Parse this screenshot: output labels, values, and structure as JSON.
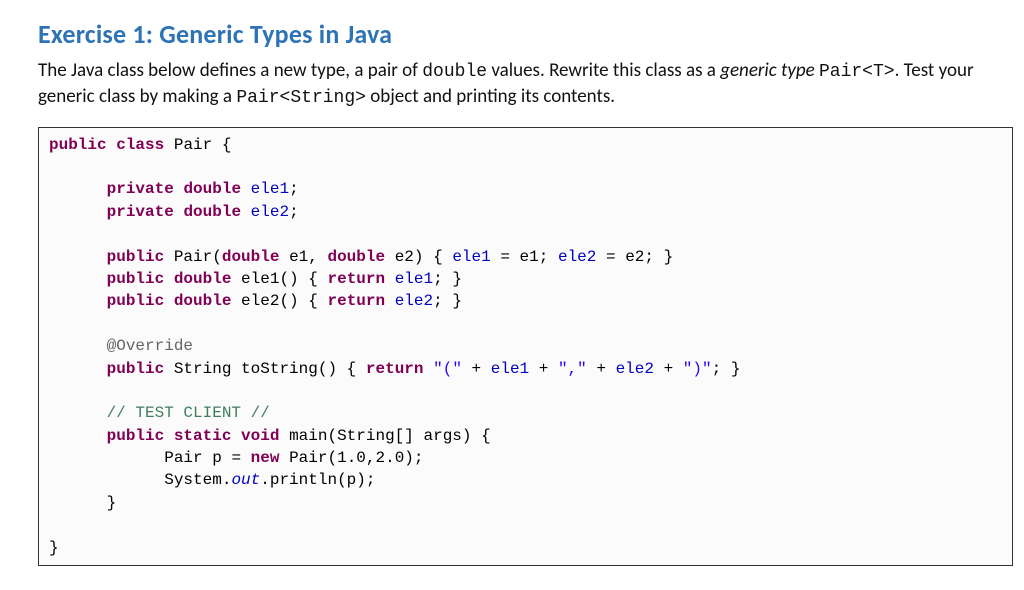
{
  "heading": "Exercise 1: Generic Types in Java",
  "intro": {
    "part1": "The Java class below defines a new type, a pair of ",
    "code1": "double",
    "part2": " values. Rewrite this class as a ",
    "italic1": "generic type",
    "part3": " ",
    "code2": "Pair<T>",
    "part4": ". Test your generic class by making a ",
    "code3": "Pair<String>",
    "part5": " object and printing its contents."
  },
  "c": {
    "kw_public": "public",
    "kw_class": "class",
    "kw_private": "private",
    "kw_double": "double",
    "kw_return": "return",
    "kw_static": "static",
    "kw_void": "void",
    "kw_new": "new",
    "name_Pair": "Pair",
    "lbrace": "{",
    "rbrace": "}",
    "fld_ele1": "ele1",
    "fld_ele2": "ele2",
    "semi": ";",
    "e1": "e1",
    "e2": "e2",
    "comma_sp": ", ",
    "open_paren": "(",
    "close_paren": ")",
    "eq": " = ",
    "ele1_fn": "ele1()",
    "ele2_fn": "ele2()",
    "override": "@Override",
    "String": "String",
    "toString": "toString()",
    "str_open_paren": "\"(\"",
    "plus": " + ",
    "str_comma": "\",\"",
    "str_close_paren": "\")\"",
    "test_comment": "// TEST CLIENT //",
    "main_sig": "main(String[] ",
    "args": "args",
    "p": "p",
    "Pair_ctor_args": "Pair(1.0,2.0)",
    "System": "System.",
    "out": "out",
    "println_call": ".println(p)"
  }
}
